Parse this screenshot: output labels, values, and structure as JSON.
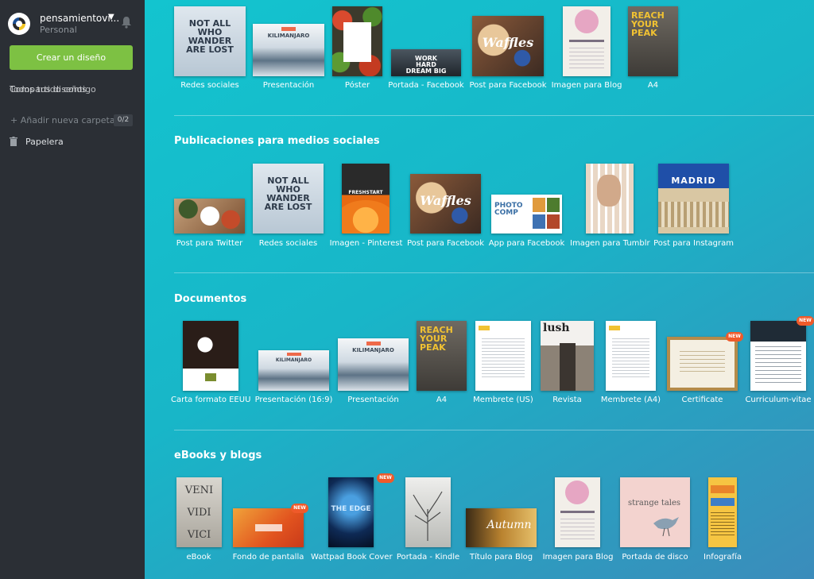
{
  "sidebar": {
    "username": "pensamientovi...",
    "plan": "Personal",
    "create_button": "Crear un diseño",
    "overlap_a": "Todos tus diseños",
    "overlap_b": "Compartido contigo",
    "add_folder": "+ Añadir nueva carpeta",
    "folder_count": "0/2",
    "trash": "Papelera"
  },
  "sections": {
    "top": {
      "items": [
        {
          "label": "Redes sociales"
        },
        {
          "label": "Presentación"
        },
        {
          "label": "Póster"
        },
        {
          "label": "Portada - Facebook"
        },
        {
          "label": "Post para Facebook"
        },
        {
          "label": "Imagen para Blog"
        },
        {
          "label": "A4"
        }
      ]
    },
    "social": {
      "title": "Publicaciones para medios sociales",
      "items": [
        {
          "label": "Post para Twitter"
        },
        {
          "label": "Redes sociales"
        },
        {
          "label": "Imagen - Pinterest"
        },
        {
          "label": "Post para Facebook"
        },
        {
          "label": "App para Facebook"
        },
        {
          "label": "Imagen para Tumblr"
        },
        {
          "label": "Post para Instagram"
        }
      ]
    },
    "documents": {
      "title": "Documentos",
      "items": [
        {
          "label": "Carta formato EEUU"
        },
        {
          "label": "Presentación (16:9)"
        },
        {
          "label": "Presentación"
        },
        {
          "label": "A4"
        },
        {
          "label": "Membrete (US)"
        },
        {
          "label": "Revista"
        },
        {
          "label": "Membrete (A4)"
        },
        {
          "label": "Certificate",
          "badge": "NEW"
        },
        {
          "label": "Curriculum-vitae",
          "badge": "NEW"
        }
      ]
    },
    "ebooks": {
      "title": "eBooks y blogs",
      "items": [
        {
          "label": "eBook"
        },
        {
          "label": "Fondo de pantalla",
          "badge": "NEW"
        },
        {
          "label": "Wattpad Book Cover",
          "badge": "NEW"
        },
        {
          "label": "Portada - Kindle"
        },
        {
          "label": "Título para Blog"
        },
        {
          "label": "Imagen para Blog"
        },
        {
          "label": "Portada de disco"
        },
        {
          "label": "Infografía"
        }
      ]
    }
  },
  "thumb_text": {
    "not_all": "NOT ALL WHO WANDER ARE LOST",
    "kilimanjaro": "KILIMANJARO",
    "work_hard": "WORK HARD DREAM BIG",
    "waffles": "Waffles",
    "reach_peak": "REACH YOUR PEAK",
    "madrid": "MADRID",
    "photo_comp": "PHOTO COMP",
    "freshstart": "FRESHSTART",
    "lush": "lush",
    "veni": "VENI",
    "vidi": "VIDI",
    "vici": "VICI",
    "the_edge": "THE EDGE",
    "autumn": "Autumn",
    "strange_tales": "strange tales"
  },
  "colors": {
    "sidebar_bg": "#2b2f35",
    "create_button": "#7dc143",
    "new_badge": "#ef5a2a",
    "main_gradient_start": "#13c4cf",
    "main_gradient_end": "#3b8cbb"
  }
}
